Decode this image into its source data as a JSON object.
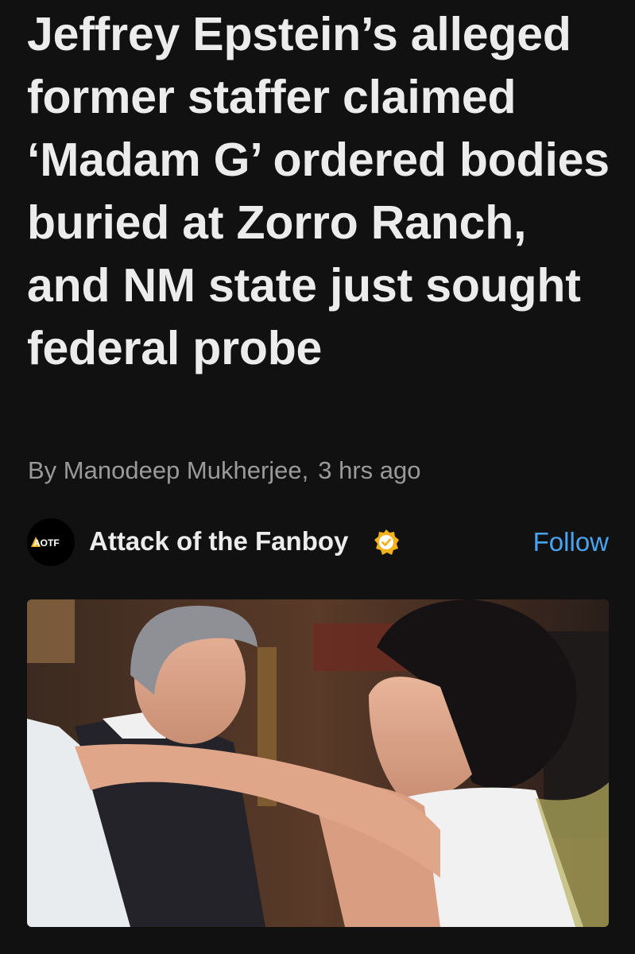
{
  "article": {
    "headline": "Jeffrey Epstein’s alleged former staffer claimed ‘Madam G’ ordered bodies buried at Zorro Ranch, and NM state just sought federal probe",
    "author": "By Manodeep Mukherjee,",
    "time": "3 hrs ago"
  },
  "source": {
    "logo_text": "AOTF",
    "name": "Attack of the Fanboy",
    "verified_icon": "verified-badge-icon",
    "follow_label": "Follow"
  },
  "colors": {
    "background": "#111111",
    "headline": "#ececec",
    "byline": "#9a9a9a",
    "follow": "#4aa3f0",
    "verified_badge": "#f2b21c"
  }
}
